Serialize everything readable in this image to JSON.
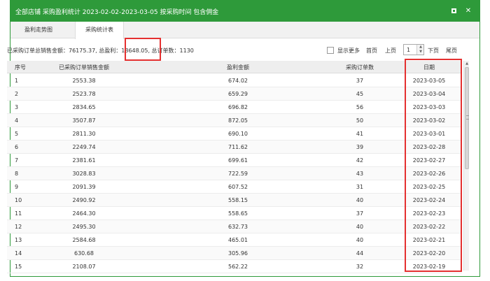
{
  "window": {
    "title": "全部店铺 采购盈利统计 2023-02-02-2023-03-05 按采购时间 包含佣金",
    "minimize_icon": "square-icon",
    "close_label": "✕"
  },
  "tabs": [
    {
      "label": "盈利走势图"
    },
    {
      "label": "采购统计表",
      "active": true
    }
  ],
  "summary": {
    "sales_label": "已采购订单总销售金额：",
    "sales_value": "76175.37",
    "profit_label": "总盈利：",
    "profit_value": "18648.05",
    "orders_label": "总订单数：",
    "orders_value": "1130"
  },
  "toolbar": {
    "show_more_label": "显示更多",
    "first_label": "首页",
    "prev_label": "上页",
    "page_value": "1",
    "next_label": "下页",
    "last_label": "尾页"
  },
  "table": {
    "headers": [
      "序号",
      "已采购订单销售金额",
      "盈利金额",
      "采购订单数",
      "日期"
    ],
    "rows": [
      [
        "1",
        "2553.38",
        "674.02",
        "37",
        "2023-03-05"
      ],
      [
        "2",
        "2523.78",
        "659.29",
        "45",
        "2023-03-04"
      ],
      [
        "3",
        "2834.65",
        "696.82",
        "56",
        "2023-03-03"
      ],
      [
        "4",
        "3507.87",
        "872.05",
        "50",
        "2023-03-02"
      ],
      [
        "5",
        "2811.30",
        "690.10",
        "41",
        "2023-03-01"
      ],
      [
        "6",
        "2249.74",
        "711.62",
        "39",
        "2023-02-28"
      ],
      [
        "7",
        "2381.61",
        "699.61",
        "42",
        "2023-02-27"
      ],
      [
        "8",
        "3028.83",
        "722.59",
        "43",
        "2023-02-26"
      ],
      [
        "9",
        "2091.39",
        "607.52",
        "31",
        "2023-02-25"
      ],
      [
        "10",
        "2490.92",
        "558.15",
        "40",
        "2023-02-24"
      ],
      [
        "11",
        "2464.30",
        "558.65",
        "37",
        "2023-02-23"
      ],
      [
        "12",
        "2495.30",
        "632.73",
        "40",
        "2023-02-22"
      ],
      [
        "13",
        "2584.68",
        "465.01",
        "40",
        "2023-02-21"
      ],
      [
        "14",
        "630.68",
        "305.96",
        "44",
        "2023-02-20"
      ],
      [
        "15",
        "2108.07",
        "562.22",
        "32",
        "2023-02-19"
      ]
    ]
  },
  "colors": {
    "titlebar": "#2e9a3a",
    "highlight": "#e43030"
  }
}
